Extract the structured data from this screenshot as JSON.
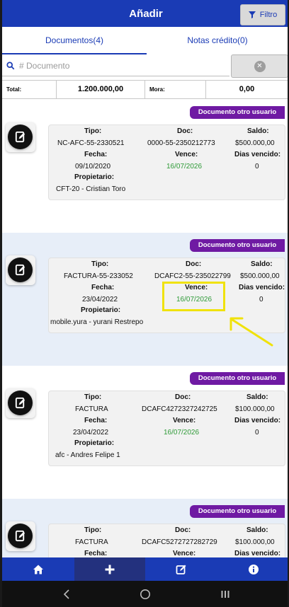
{
  "header": {
    "title": "Añadir",
    "filter_label": "Filtro"
  },
  "tabs": [
    {
      "label": "Documentos(4)"
    },
    {
      "label": "Notas crédito(0)"
    }
  ],
  "search": {
    "placeholder": "# Documento",
    "value": ""
  },
  "totals": {
    "total_label": "Total:",
    "total_value": "1.200.000,00",
    "mora_label": "Mora:",
    "mora_value": "0,00"
  },
  "labels": {
    "tipo": "Tipo:",
    "doc": "Doc:",
    "saldo": "Saldo:",
    "fecha": "Fecha:",
    "vence": "Vence:",
    "dias_vencido": "Dias vencido:",
    "propietario": "Propietario:"
  },
  "documents": [
    {
      "badge": "Documento otro usuario",
      "tipo": "NC-AFC-55-2330521",
      "doc": "0000-55-2350212773",
      "saldo": "$500.000,00",
      "fecha": "09/10/2020",
      "vence": "16/07/2026",
      "dias_vencido": "0",
      "propietario": "CFT-20 - Cristian Toro"
    },
    {
      "badge": "Documento otro usuario",
      "tipo": "FACTURA-55-233052",
      "doc": "DCAFC2-55-235022799",
      "saldo": "$500.000,00",
      "fecha": "23/04/2022",
      "vence": "16/07/2026",
      "dias_vencido": "0",
      "propietario": "mobile.yura - yurani Restrepo"
    },
    {
      "badge": "Documento otro usuario",
      "tipo": "FACTURA",
      "doc": "DCAFC4272327242725",
      "saldo": "$100.000,00",
      "fecha": "23/04/2022",
      "vence": "16/07/2026",
      "dias_vencido": "0",
      "propietario": "afc - Andres Felipe 1"
    },
    {
      "badge": "Documento otro usuario",
      "tipo": "FACTURA",
      "doc": "DCAFC5272727282729",
      "saldo": "$100.000,00",
      "fecha": "",
      "vence": "",
      "dias_vencido": "",
      "propietario": ""
    }
  ],
  "bottom_nav": [
    {
      "icon": "home-icon"
    },
    {
      "icon": "plus-icon",
      "active": true
    },
    {
      "icon": "edit-icon"
    },
    {
      "icon": "info-icon"
    }
  ],
  "colors": {
    "primary": "#1a3bb5",
    "badge": "#6f1aa3",
    "due_date": "#2e9a37",
    "highlight": "#f0e20b"
  }
}
